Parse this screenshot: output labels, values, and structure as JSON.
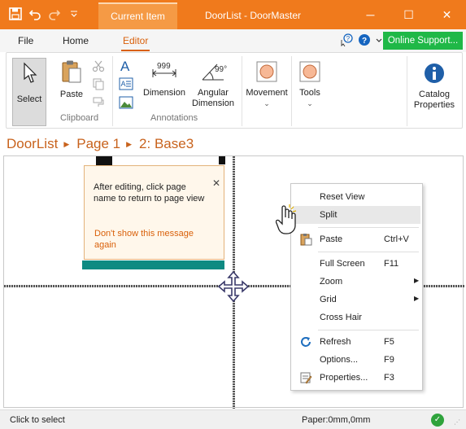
{
  "window": {
    "context_tab": "Current Item",
    "title": "DoorList - DoorMaster",
    "minimize": "─",
    "maximize": "☐",
    "close": "✕"
  },
  "qat": {
    "save_icon": "save-icon",
    "undo_icon": "undo-icon",
    "redo_icon": "redo-icon",
    "customize_icon": "customize-qat-icon"
  },
  "ribbon_tabs": [
    {
      "label": "File"
    },
    {
      "label": "Home"
    },
    {
      "label": "Editor"
    }
  ],
  "online_support": "Online Support...",
  "ribbon": {
    "select": "Select",
    "paste": "Paste",
    "clipboard_group": "Clipboard",
    "dimension": "Dimension",
    "dimension_value": "999",
    "angular_line1": "Angular",
    "angular_line2": "Dimension",
    "angular_value": "99°",
    "annotations_group": "Annotations",
    "movement": "Movement",
    "tools": "Tools",
    "catalog_line1": "Catalog",
    "catalog_line2": "Properties",
    "dropdown_glyph": "⌄"
  },
  "breadcrumb": [
    "DoorList",
    "Page 1",
    "2: Base3"
  ],
  "breadcrumb_sep": "▶",
  "callout": {
    "message": "After editing, click page name to return to page view",
    "link": "Don't show this message again",
    "close": "✕"
  },
  "context_menu": [
    {
      "label": "Reset View",
      "shortcut": "",
      "submenu": false
    },
    {
      "label": "Split",
      "shortcut": "",
      "submenu": false,
      "highlighted": true
    },
    {
      "label": "Paste",
      "shortcut": "Ctrl+V",
      "submenu": false,
      "icon": "paste-icon"
    },
    {
      "label": "Full Screen",
      "shortcut": "F11",
      "submenu": false
    },
    {
      "label": "Zoom",
      "shortcut": "",
      "submenu": true
    },
    {
      "label": "Grid",
      "shortcut": "",
      "submenu": true
    },
    {
      "label": "Cross Hair",
      "shortcut": "",
      "submenu": false
    },
    {
      "label": "Refresh",
      "shortcut": "F5",
      "submenu": false,
      "icon": "refresh-icon"
    },
    {
      "label": "Options...",
      "shortcut": "F9",
      "submenu": false
    },
    {
      "label": "Properties...",
      "shortcut": "F3",
      "submenu": false,
      "icon": "properties-icon"
    }
  ],
  "submenu_glyph": "▶",
  "status": {
    "left": "Click to select",
    "paper": "Paper:0mm,0mm",
    "ok_glyph": "✓",
    "grip": "⋰"
  },
  "colors": {
    "accent": "#f07a1c",
    "editor_tab": "#d9600a",
    "online_support": "#1fb847",
    "teal_bar": "#0e8a82"
  }
}
